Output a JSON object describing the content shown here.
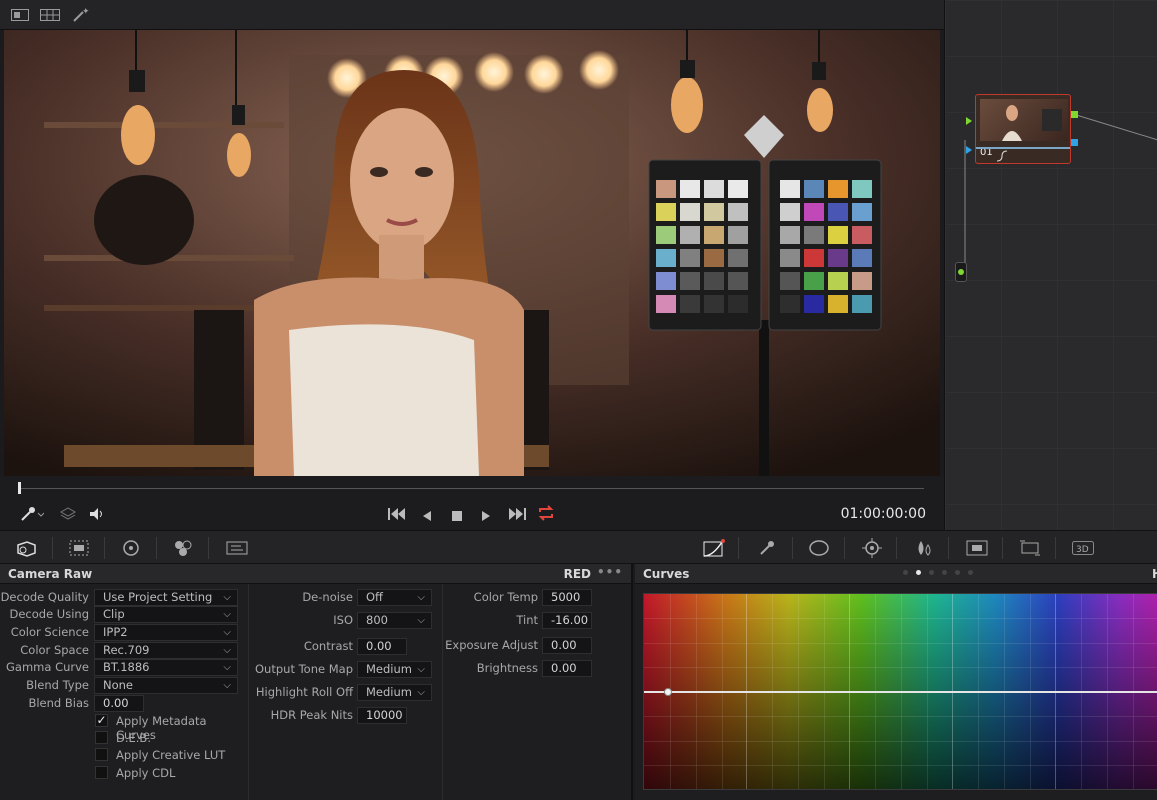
{
  "viewer": {
    "timecode": "01:00:00:00"
  },
  "node": {
    "label": "01"
  },
  "camera_raw": {
    "title": "Camera Raw",
    "format_badge": "RED",
    "more": "•••",
    "left": [
      {
        "label": "Decode Quality",
        "value": "Use Project Setting"
      },
      {
        "label": "Decode Using",
        "value": "Clip"
      },
      {
        "label": "Color Science",
        "value": "IPP2"
      },
      {
        "label": "Color Space",
        "value": "Rec.709"
      },
      {
        "label": "Gamma Curve",
        "value": "BT.1886"
      },
      {
        "label": "Blend Type",
        "value": "None"
      }
    ],
    "blend_bias": {
      "label": "Blend Bias",
      "value": "0.00"
    },
    "checkboxes": [
      {
        "label": "Apply Metadata Curves",
        "checked": true
      },
      {
        "label": "D.E.B.",
        "checked": false
      },
      {
        "label": "Apply Creative LUT",
        "checked": false
      },
      {
        "label": "Apply CDL",
        "checked": false
      }
    ],
    "middle": {
      "denoise": {
        "label": "De-noise",
        "value": "Off"
      },
      "iso": {
        "label": "ISO",
        "value": "800"
      },
      "contrast": {
        "label": "Contrast",
        "value": "0.00"
      },
      "tone_map": {
        "label": "Output Tone Map",
        "value": "Medium"
      },
      "rolloff": {
        "label": "Highlight Roll Off",
        "value": "Medium"
      },
      "hdr_nits": {
        "label": "HDR Peak Nits",
        "value": "10000"
      }
    },
    "right": {
      "color_temp": {
        "label": "Color Temp",
        "value": "5000"
      },
      "tint": {
        "label": "Tint",
        "value": "-16.00"
      },
      "exposure": {
        "label": "Exposure Adjust",
        "value": "0.00"
      },
      "brightness": {
        "label": "Brightness",
        "value": "0.00"
      }
    }
  },
  "curves": {
    "title": "Curves",
    "cut_label": "H",
    "page_index": 2,
    "page_count": 6
  },
  "icons": {
    "viewer_top": [
      "single-viewer-icon",
      "split-viewer-icon",
      "magic-wand-icon"
    ],
    "palette_left": [
      "camera-raw-icon",
      "color-match-icon",
      "color-wheels-icon",
      "rgb-mixer-icon",
      "motion-effects-icon"
    ],
    "palette_right": [
      "curves-icon",
      "qualifier-icon",
      "window-icon",
      "tracker-icon",
      "blur-icon",
      "key-icon",
      "sizing-icon",
      "3d-icon"
    ]
  },
  "colors": {
    "accent_red": "#e0463c",
    "node_border": "#c0392b",
    "link_green": "#7fd832",
    "link_blue": "#2fa3e6"
  }
}
